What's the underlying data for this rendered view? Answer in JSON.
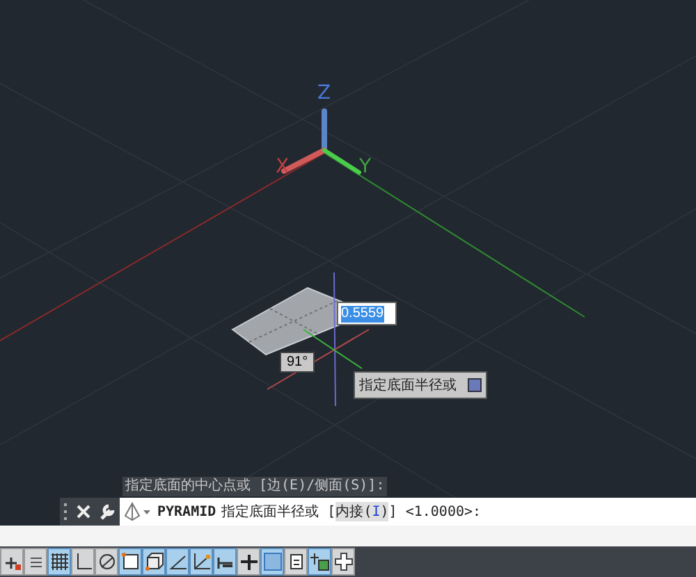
{
  "viewport": {
    "axis_labels": {
      "x": "X",
      "y": "Y",
      "z": "Z"
    },
    "dynamic_input": {
      "value": "0.5559"
    },
    "angle_readout": "91°",
    "tooltip": "指定底面半径或"
  },
  "command_history": "指定底面的中心点或 [边(E)/侧面(S)]:",
  "command_line": {
    "command": "PYRAMID",
    "prompt": "指定底面半径或 [",
    "option": {
      "text": "内接(",
      "key": "I",
      "close": ")"
    },
    "rest": "] <1.0000>:"
  },
  "status_toggles": [
    {
      "kind": "snap",
      "on": false
    },
    {
      "kind": "dots",
      "on": false
    },
    {
      "kind": "grid",
      "on": true
    },
    {
      "kind": "ortho",
      "on": false
    },
    {
      "kind": "polar",
      "on": false
    },
    {
      "kind": "square",
      "on": true
    },
    {
      "kind": "cube",
      "on": true
    },
    {
      "kind": "angle",
      "on": true
    },
    {
      "kind": "dynucs",
      "on": true
    },
    {
      "kind": "lwt",
      "on": true
    },
    {
      "kind": "cross",
      "on": false
    },
    {
      "kind": "transparency",
      "on": true
    },
    {
      "kind": "panel",
      "on": false
    },
    {
      "kind": "select",
      "on": true
    },
    {
      "kind": "plus",
      "on": false
    }
  ]
}
